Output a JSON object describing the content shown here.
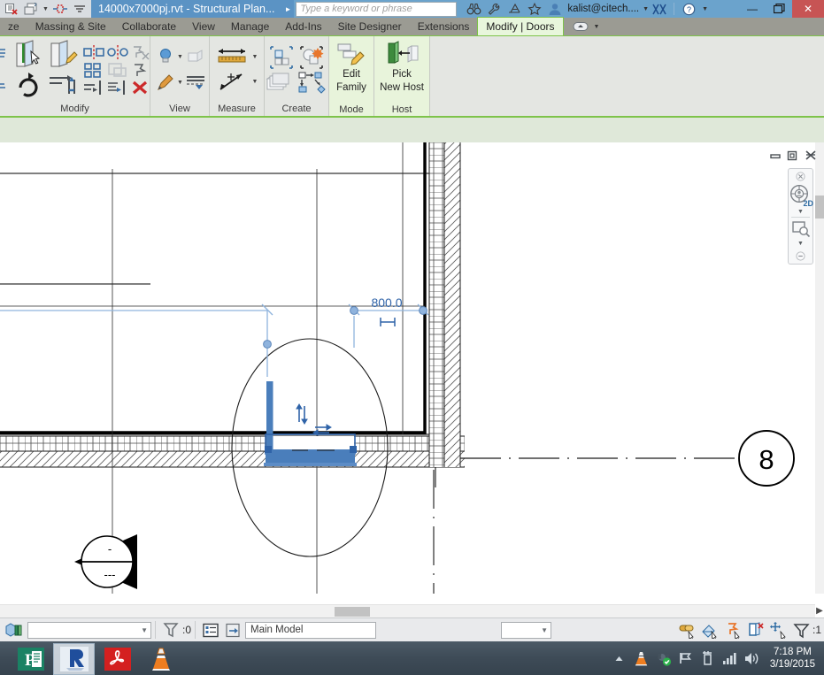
{
  "titlebar": {
    "document_title": "14000x7000pj.rvt - Structural Plan...",
    "search_placeholder": "Type a keyword or phrase",
    "user": "kalist@citech....",
    "icons": [
      "quick-print-icon",
      "switch-window-icon",
      "sync-icon",
      "qat-dropdown-icon",
      "binoculars-icon",
      "wrench-icon",
      "satellite-icon",
      "star-icon",
      "user-icon",
      "autodesk-exchange-icon",
      "help-icon"
    ],
    "window_buttons": {
      "minimize": "—",
      "maximize": "❐",
      "close": "✕"
    }
  },
  "tabs": [
    {
      "label": "ze",
      "active": false
    },
    {
      "label": "Massing & Site",
      "active": false
    },
    {
      "label": "Collaborate",
      "active": false
    },
    {
      "label": "View",
      "active": false
    },
    {
      "label": "Manage",
      "active": false
    },
    {
      "label": "Add-Ins",
      "active": false
    },
    {
      "label": "Site Designer",
      "active": false
    },
    {
      "label": "Extensions",
      "active": false
    },
    {
      "label": "Modify | Doors",
      "active": true
    }
  ],
  "ribbon": {
    "panels": [
      {
        "name": "Modify",
        "title": "Modify"
      },
      {
        "name": "View",
        "title": "View"
      },
      {
        "name": "Measure",
        "title": "Measure"
      },
      {
        "name": "Create",
        "title": "Create"
      },
      {
        "name": "Mode",
        "title": "Mode"
      },
      {
        "name": "Host",
        "title": "Host"
      }
    ],
    "edit_family_line1": "Edit",
    "edit_family_line2": "Family",
    "pick_new_host_line1": "Pick",
    "pick_new_host_line2": "New Host"
  },
  "canvas": {
    "dimension_value": "800.0",
    "grid_bubble_label": "8",
    "section_marker_top": "-",
    "section_marker_bottom": "---",
    "navbar": {
      "viewcube_label": "2D",
      "tools": [
        "steering-wheel-icon",
        "zoom-region-icon"
      ]
    },
    "view_controls": {
      "minimize": "minimize-view",
      "restore": "restore-view",
      "close": "close-view"
    }
  },
  "statusbar": {
    "press_tab_hint": "",
    "filter_count": ":0",
    "workset": "Main Model",
    "blank_field": "",
    "selection_count": ":1",
    "left_icons": [
      "model-review-icon"
    ],
    "mid_icons": [
      "design-options-icon",
      "exclude-option-icon"
    ],
    "right_icons": [
      "select-links-icon",
      "select-underlay-icon",
      "select-pinned-icon",
      "select-by-face-icon",
      "drag-element-icon",
      "filter-icon"
    ]
  },
  "taskbar": {
    "apps": [
      {
        "name": "publisher",
        "label": "P",
        "active": false
      },
      {
        "name": "revit",
        "label": "R",
        "active": true
      },
      {
        "name": "acrobat",
        "label": "A",
        "active": false
      },
      {
        "name": "vlc",
        "label": "",
        "active": false
      }
    ],
    "tray_icons": [
      "show-hidden-icons-arrow",
      "vlc-tray-icon",
      "security-shield-icon",
      "flag-icon",
      "battery-icon",
      "network-signal-icon",
      "volume-icon"
    ],
    "time": "7:18 PM",
    "date": "3/19/2015"
  },
  "colors": {
    "title_bar": "#6ba3cc",
    "ribbon_accent_green": "#7ec34a",
    "active_tab_bg": "#e8f6dc",
    "selection_blue": "#4a7ebb",
    "close_red": "#c75454"
  }
}
